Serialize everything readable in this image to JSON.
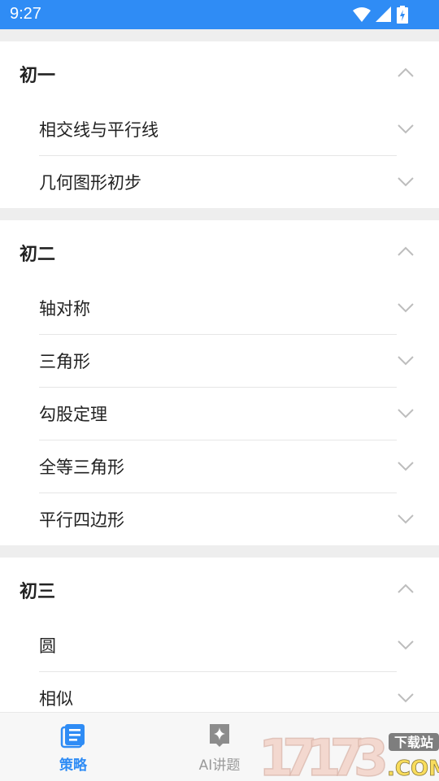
{
  "status_bar": {
    "time": "9:27"
  },
  "sections": [
    {
      "title": "初一",
      "items": [
        "相交线与平行线",
        "几何图形初步"
      ]
    },
    {
      "title": "初二",
      "items": [
        "轴对称",
        "三角形",
        "勾股定理",
        "全等三角形",
        "平行四边形"
      ]
    },
    {
      "title": "初三",
      "items": [
        "圆",
        "相似"
      ]
    }
  ],
  "bottom_nav": {
    "tabs": [
      {
        "label": "策略",
        "icon": "list-icon"
      },
      {
        "label": "AI讲题",
        "icon": "sparkle-icon"
      }
    ]
  },
  "watermark": {
    "text": "17173",
    "badge": "下载站",
    "suffix": ".COM"
  },
  "colors": {
    "accent": "#2f8cf5",
    "divider": "#e6e6e6",
    "background": "#eeeeee"
  }
}
